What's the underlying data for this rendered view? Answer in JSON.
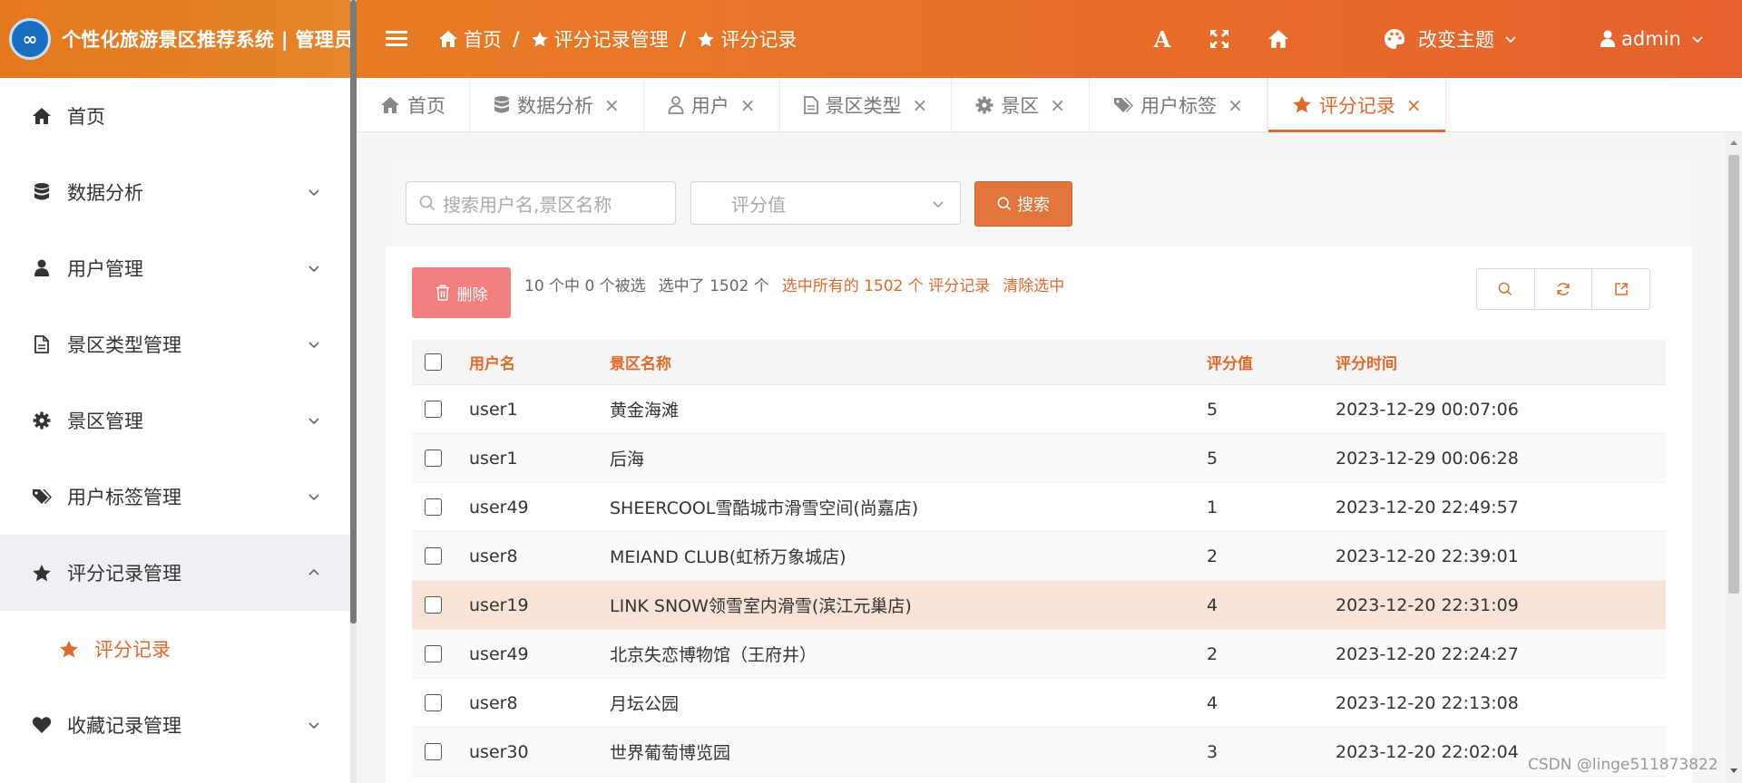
{
  "app": {
    "logo_text": "∞",
    "title": "个性化旅游景区推荐系统 | 管理员"
  },
  "colors": {
    "accent": "#e0692c",
    "header_start": "#e87c25",
    "header_end": "#e6622e",
    "danger": "#f37f7f",
    "highlight_row": "#f8e3d9"
  },
  "sidebar": {
    "items": [
      {
        "label": "首页",
        "icon": "home-icon"
      },
      {
        "label": "数据分析",
        "icon": "database-icon"
      },
      {
        "label": "用户管理",
        "icon": "user-icon"
      },
      {
        "label": "景区类型管理",
        "icon": "file-icon"
      },
      {
        "label": "景区管理",
        "icon": "gear-icon"
      },
      {
        "label": "用户标签管理",
        "icon": "tags-icon"
      },
      {
        "label": "评分记录管理",
        "icon": "star-icon"
      },
      {
        "label": "收藏记录管理",
        "icon": "heart-icon"
      }
    ],
    "sub_item": {
      "label": "评分记录",
      "icon": "star-icon"
    }
  },
  "header": {
    "breadcrumb": [
      {
        "label": "首页",
        "icon": "home-icon"
      },
      {
        "label": "评分记录管理",
        "icon": "star-icon"
      },
      {
        "label": "评分记录",
        "icon": "star-icon"
      }
    ],
    "breadcrumb_sep": "/",
    "font_icon_glyph": "A",
    "theme_label": "改变主题",
    "user_label": "admin"
  },
  "tabs": [
    {
      "label": "首页",
      "icon": "home-icon",
      "closable": false
    },
    {
      "label": "数据分析",
      "icon": "database-icon",
      "closable": true
    },
    {
      "label": "用户",
      "icon": "user-icon",
      "closable": true
    },
    {
      "label": "景区类型",
      "icon": "file-icon",
      "closable": true
    },
    {
      "label": "景区",
      "icon": "gear-icon",
      "closable": true
    },
    {
      "label": "用户标签",
      "icon": "tags-icon",
      "closable": true
    },
    {
      "label": "评分记录",
      "icon": "star-icon",
      "closable": true,
      "active": true
    }
  ],
  "tab_close_glyph": "×",
  "search": {
    "keyword_placeholder": "搜索用户名,景区名称",
    "score_placeholder": "评分值",
    "button_label": "搜索"
  },
  "toolbar": {
    "delete_label": "删除",
    "selected_info": "10 个中 0 个被选",
    "selected_total": "选中了 1502 个",
    "select_all_link": "选中所有的 1502 个 评分记录",
    "clear_link": "清除选中"
  },
  "table": {
    "columns": [
      "用户名",
      "景区名称",
      "评分值",
      "评分时间"
    ],
    "rows": [
      {
        "user": "user1",
        "scenic": "黄金海滩",
        "score": "5",
        "time": "2023-12-29 00:07:06"
      },
      {
        "user": "user1",
        "scenic": "后海",
        "score": "5",
        "time": "2023-12-29 00:06:28"
      },
      {
        "user": "user49",
        "scenic": "SHEERCOOL雪酷城市滑雪空间(尚嘉店)",
        "score": "1",
        "time": "2023-12-20 22:49:57"
      },
      {
        "user": "user8",
        "scenic": "MEIAND CLUB(虹桥万象城店)",
        "score": "2",
        "time": "2023-12-20 22:39:01"
      },
      {
        "user": "user19",
        "scenic": "LINK SNOW领雪室内滑雪(滨江元巢店)",
        "score": "4",
        "time": "2023-12-20 22:31:09"
      },
      {
        "user": "user49",
        "scenic": "北京失恋博物馆（王府井）",
        "score": "2",
        "time": "2023-12-20 22:24:27"
      },
      {
        "user": "user8",
        "scenic": "月坛公园",
        "score": "4",
        "time": "2023-12-20 22:13:08"
      },
      {
        "user": "user30",
        "scenic": "世界葡萄博览园",
        "score": "3",
        "time": "2023-12-20 22:02:04"
      }
    ]
  },
  "watermark": "CSDN @linge511873822"
}
